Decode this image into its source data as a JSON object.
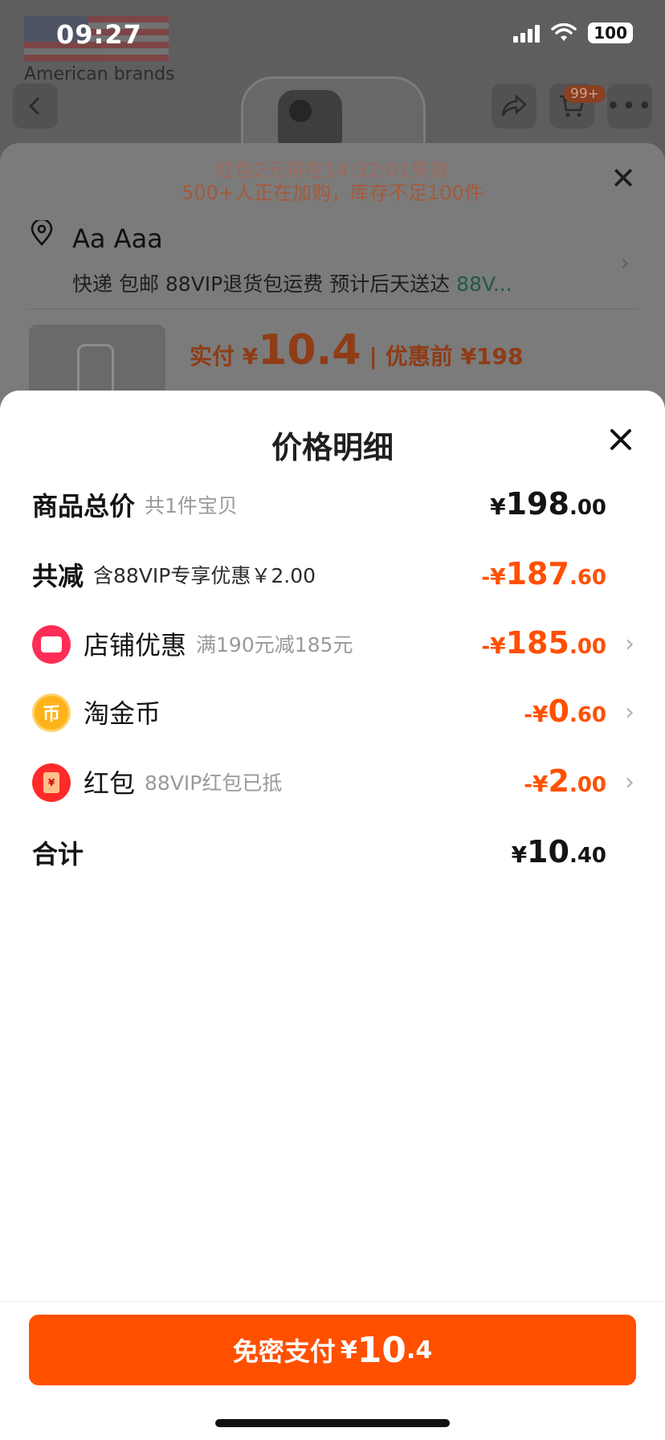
{
  "status_bar": {
    "time": "09:27",
    "battery": "100"
  },
  "background_page": {
    "brand_caption": "American brands",
    "cart_badge": "99+"
  },
  "order_sheet": {
    "promo_countdown": "红包2元将在14:32:01失效",
    "promo_stock": "500+人正在加购，库存不足100件",
    "address_name": "Aa Aaa",
    "delivery_text": "快递 包邮 88VIP退货包运费 预计后天送达",
    "delivery_vip": "88V...",
    "pay_label": "实付 ¥",
    "pay_amount": "10.4",
    "before_label": "优惠前 ¥198"
  },
  "price_detail": {
    "title": "价格明细",
    "rows": [
      {
        "label": "商品总价",
        "sub": "共1件宝贝",
        "currency": "¥",
        "int": "198",
        "dec": ".00",
        "sign": ""
      },
      {
        "label": "共减",
        "sub": "含88VIP专享优惠￥2.00",
        "currency": "¥",
        "int": "187",
        "dec": ".60",
        "sign": "-"
      },
      {
        "label": "店铺优惠",
        "sub": "满190元减185元",
        "currency": "¥",
        "int": "185",
        "dec": ".00",
        "sign": "-",
        "icon": "shop-icon"
      },
      {
        "label": "淘金币",
        "sub": "",
        "currency": "¥",
        "int": "0",
        "dec": ".60",
        "sign": "-",
        "icon": "gold-coin-icon"
      },
      {
        "label": "红包",
        "sub": "88VIP红包已抵",
        "currency": "¥",
        "int": "2",
        "dec": ".00",
        "sign": "-",
        "icon": "red-packet-icon"
      },
      {
        "label": "合计",
        "sub": "",
        "currency": "¥",
        "int": "10",
        "dec": ".40",
        "sign": ""
      }
    ],
    "coin_icon_char": "币",
    "red_packet_icon_char": "¥"
  },
  "pay_button": {
    "label": "免密支付",
    "currency": "¥",
    "int": "10",
    "dec": ".4"
  },
  "colors": {
    "accent": "#ff5000",
    "shop_icon": "#ff2d55",
    "coin_icon": "#ffb31a",
    "red_packet_icon": "#ff2b2b"
  }
}
